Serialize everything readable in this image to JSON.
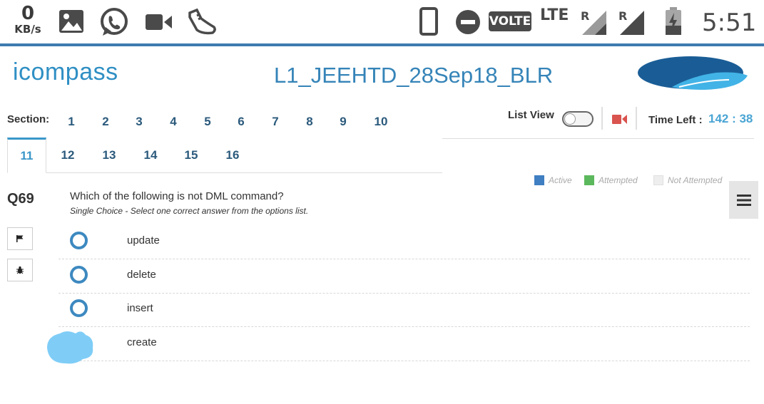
{
  "status_bar": {
    "speed_value": "0",
    "speed_unit": "KB/s",
    "icons": [
      "image-icon",
      "whatsapp-icon",
      "video-icon",
      "shoe-icon",
      "phone-portrait-icon",
      "do-not-disturb-icon",
      "signal-icon",
      "battery-charging-icon"
    ],
    "volte": "VOLTE",
    "lte": "LTE",
    "roaming_1": "R",
    "roaming_2": "R",
    "clock": "5:51"
  },
  "header": {
    "logo": "icompass",
    "exam_title": "L1_JEEHTD_28Sep18_BLR"
  },
  "sections": {
    "label": "Section:",
    "row1": [
      "1",
      "2",
      "3",
      "4",
      "5",
      "6",
      "7",
      "8",
      "9",
      "10"
    ],
    "row2": [
      "11",
      "12",
      "13",
      "14",
      "15",
      "16"
    ],
    "active": "11"
  },
  "toolbar": {
    "list_view_label": "List View",
    "time_left_label": "Time Left :",
    "time_left_value": "142 : 38"
  },
  "legend": {
    "active": "Active",
    "attempted": "Attempted",
    "not_attempted": "Not Attempted",
    "colors": {
      "active": "#3f7fc2",
      "attempted": "#5cb85c",
      "not_attempted": "#eeeeee"
    }
  },
  "question": {
    "number": "Q69",
    "text": "Which of the following is not DML command?",
    "hint": "Single Choice - Select one correct answer from the options list.",
    "options": [
      "update",
      "delete",
      "insert",
      "create"
    ]
  },
  "colors": {
    "accent": "#3584b8",
    "radio": "#3d89c0",
    "timer": "#4aa5d4",
    "camera": "#d9534f"
  }
}
